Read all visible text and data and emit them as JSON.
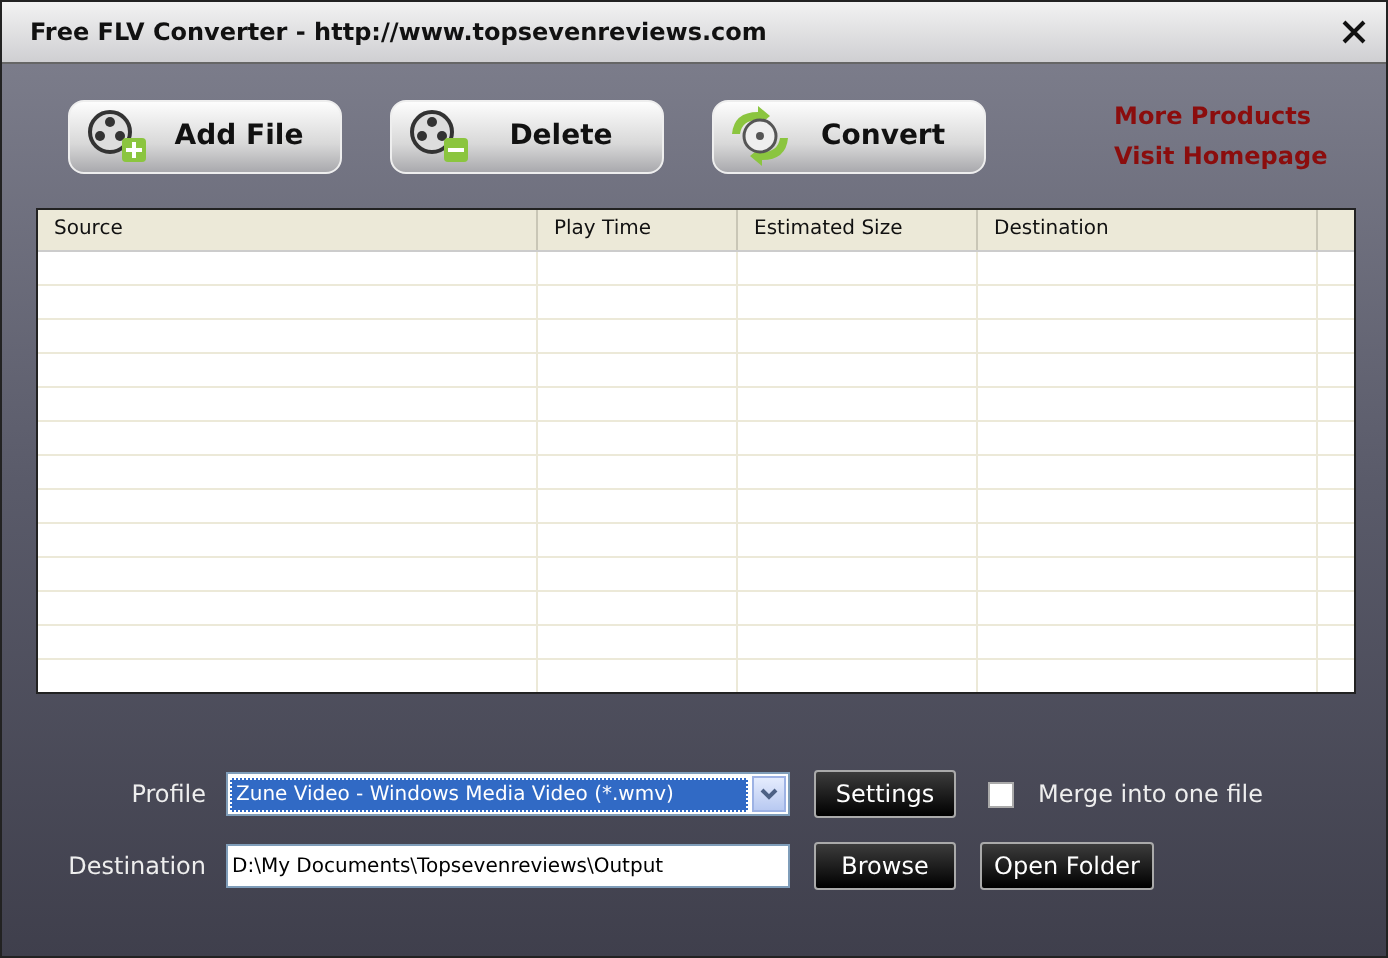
{
  "window": {
    "title": "Free FLV Converter - http://www.topsevenreviews.com"
  },
  "toolbar": [
    {
      "kind": "add",
      "label": "Add File"
    },
    {
      "kind": "delete",
      "label": "Delete"
    },
    {
      "kind": "convert",
      "label": "Convert"
    }
  ],
  "links": [
    "More Products",
    "Visit Homepage"
  ],
  "table": {
    "columns": [
      "Source",
      "Play Time",
      "Estimated Size",
      "Destination"
    ]
  },
  "profile": {
    "label": "Profile",
    "value": "Zune Video - Windows Media Video (*.wmv)",
    "button": "Settings"
  },
  "merge": {
    "label": "Merge into one file",
    "checked": false
  },
  "destination": {
    "label": "Destination",
    "value": "D:\\My Documents\\Topsevenreviews\\Output",
    "buttons": [
      "Browse",
      "Open Folder"
    ]
  }
}
